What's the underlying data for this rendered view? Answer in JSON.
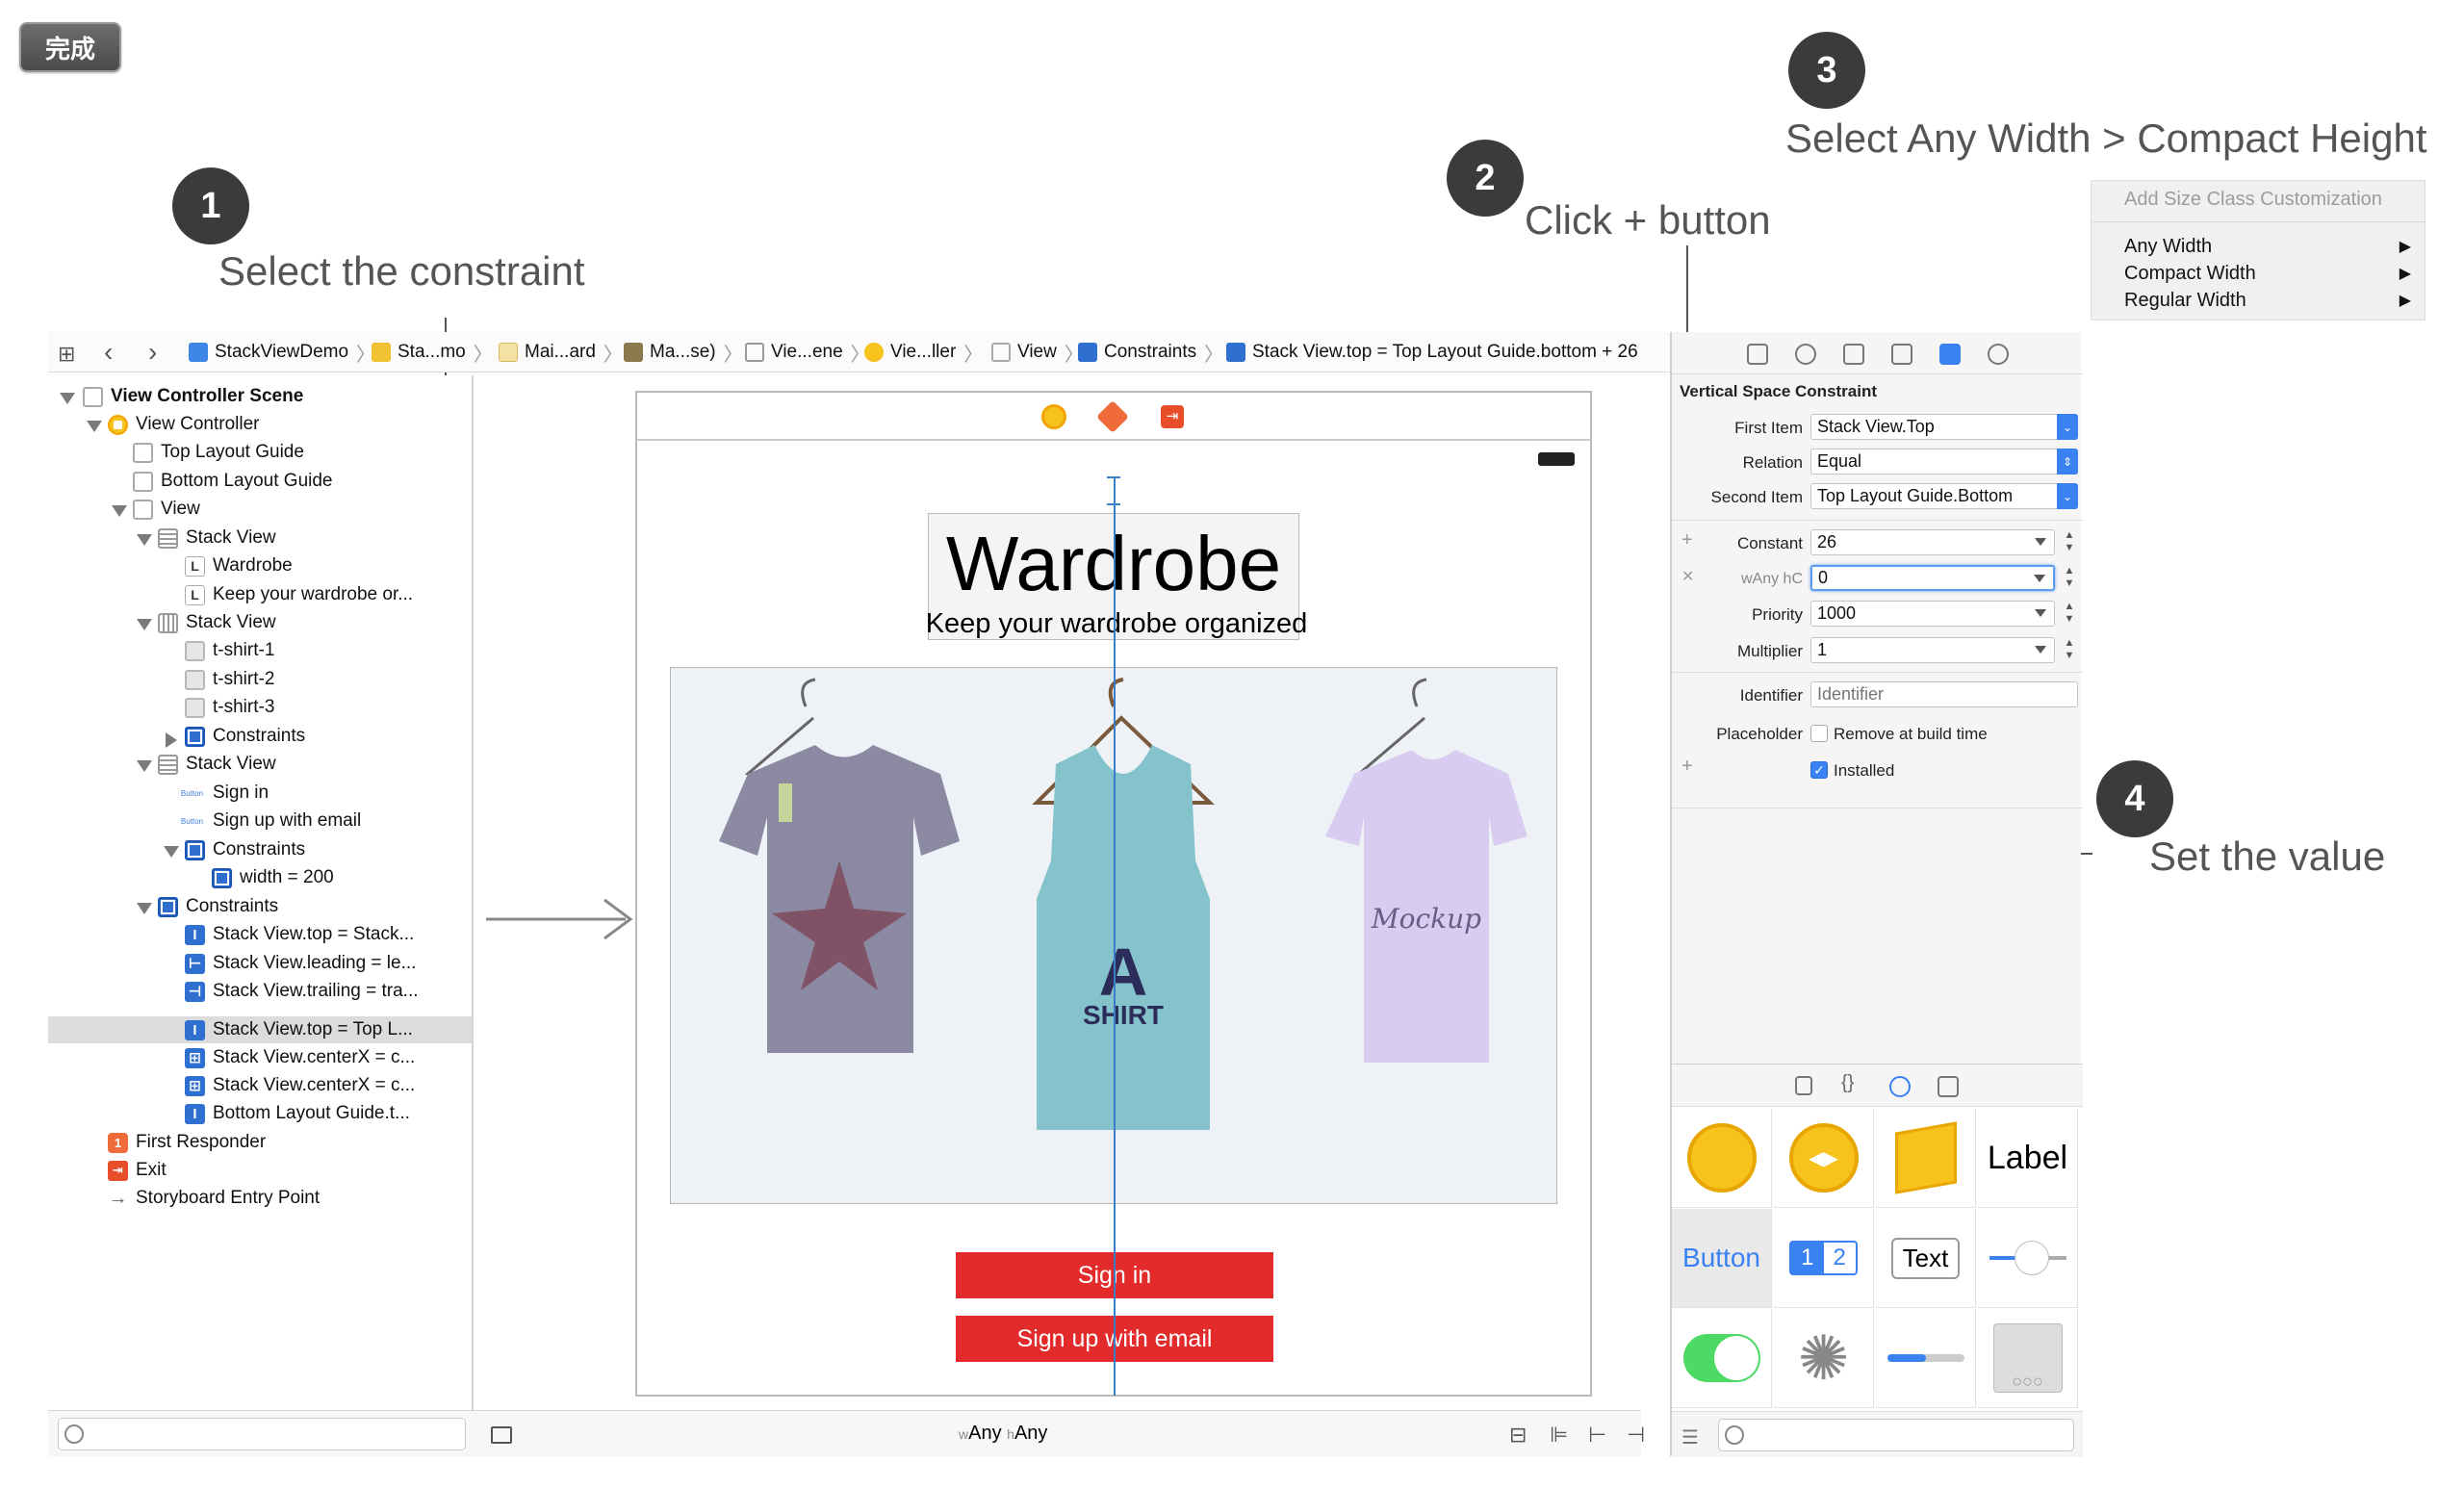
{
  "done_button": "完成",
  "annotations": {
    "step1": {
      "num": "1",
      "text": "Select the constraint"
    },
    "step2": {
      "num": "2",
      "text": "Click + button"
    },
    "step3": {
      "num": "3",
      "text": "Select Any Width > Compact Height"
    },
    "step4": {
      "num": "4",
      "text": "Set the value"
    }
  },
  "size_class_menu": {
    "header": "Add Size Class Customization",
    "items": [
      "Any Width",
      "Compact Width",
      "Regular Width"
    ]
  },
  "jump_bar": {
    "crumbs": [
      "StackViewDemo",
      "Sta...mo",
      "Mai...ard",
      "Ma...se)",
      "Vie...ene",
      "Vie...ller",
      "View",
      "Constraints",
      "Stack View.top = Top Layout Guide.bottom + 26"
    ]
  },
  "outline": {
    "items": [
      "View Controller Scene",
      "View Controller",
      "Top Layout Guide",
      "Bottom Layout Guide",
      "View",
      "Stack View",
      "Wardrobe",
      "Keep your wardrobe or...",
      "Stack View",
      "t-shirt-1",
      "t-shirt-2",
      "t-shirt-3",
      "Constraints",
      "Stack View",
      "Sign in",
      "Sign up with email",
      "Constraints",
      "width = 200",
      "Constraints",
      "Stack View.top = Stack...",
      "Stack View.leading = le...",
      "Stack View.trailing = tra...",
      "Stack View.top = Top L...",
      "Stack View.centerX = c...",
      "Stack View.centerX = c...",
      "Bottom Layout Guide.t...",
      "First Responder",
      "Exit",
      "Storyboard Entry Point"
    ]
  },
  "canvas": {
    "title": "Wardrobe",
    "subtitle": "Keep your wardrobe organized",
    "sign_in": "Sign in",
    "sign_up": "Sign up with email",
    "shirt2_text": "SHIRT",
    "shirt3_text": "Mockup",
    "size_class_w": "w",
    "size_class_w_val": "Any",
    "size_class_h": "h",
    "size_class_h_val": "Any"
  },
  "inspector": {
    "section_title": "Vertical Space Constraint",
    "first_item_label": "First Item",
    "first_item_value": "Stack View.Top",
    "relation_label": "Relation",
    "relation_value": "Equal",
    "second_item_label": "Second Item",
    "second_item_value": "Top Layout Guide.Bottom",
    "constant_label": "Constant",
    "constant_value": "26",
    "size_class_label": "wAny hC",
    "size_class_value": "0",
    "priority_label": "Priority",
    "priority_value": "1000",
    "multiplier_label": "Multiplier",
    "multiplier_value": "1",
    "identifier_label": "Identifier",
    "identifier_placeholder": "Identifier",
    "placeholder_label": "Placeholder",
    "remove_label": "Remove at build time",
    "installed_label": "Installed"
  },
  "library": {
    "label_text": "Label",
    "button_text": "Button",
    "seg1": "1",
    "seg2": "2",
    "text_text": "Text"
  },
  "colors": {
    "accent": "#3a82f3",
    "button_red": "#e32b2b",
    "guide_blue": "#3a7dc9"
  }
}
